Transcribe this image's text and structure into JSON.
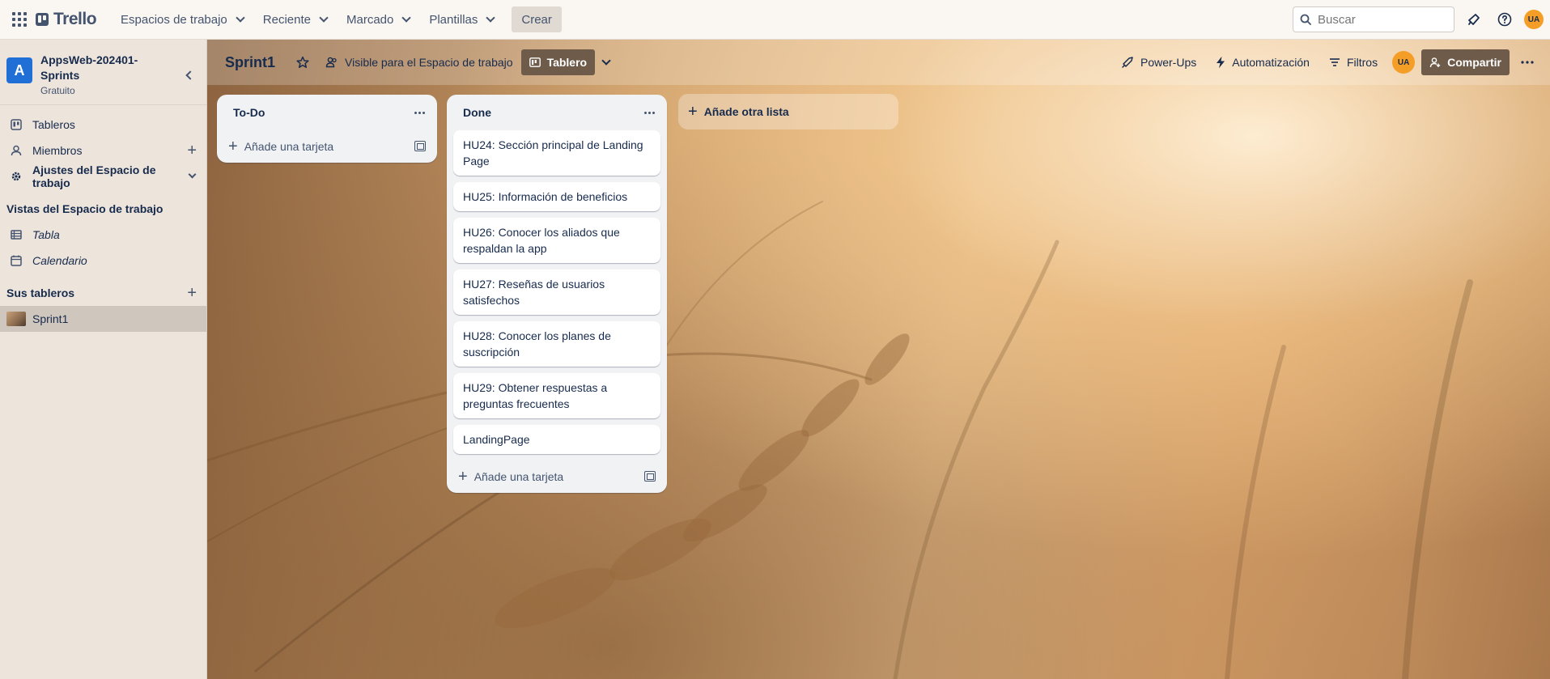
{
  "topbar": {
    "logo": "Trello",
    "nav": [
      {
        "label": "Espacios de trabajo"
      },
      {
        "label": "Reciente"
      },
      {
        "label": "Marcado"
      },
      {
        "label": "Plantillas"
      }
    ],
    "create_label": "Crear",
    "search_placeholder": "Buscar",
    "avatar_initials": "UA"
  },
  "sidebar": {
    "workspace_initial": "A",
    "workspace_name": "AppsWeb-202401-Sprints",
    "workspace_plan": "Gratuito",
    "items": [
      {
        "label": "Tableros"
      },
      {
        "label": "Miembros"
      },
      {
        "label": "Ajustes del Espacio de trabajo"
      }
    ],
    "views_title": "Vistas del Espacio de trabajo",
    "views": [
      {
        "label": "Tabla"
      },
      {
        "label": "Calendario"
      }
    ],
    "boards_title": "Sus tableros",
    "boards": [
      {
        "label": "Sprint1"
      }
    ]
  },
  "board": {
    "title": "Sprint1",
    "visibility_label": "Visible para el Espacio de trabajo",
    "view_label": "Tablero",
    "powerups_label": "Power-Ups",
    "automation_label": "Automatización",
    "filters_label": "Filtros",
    "member_initials": "UA",
    "share_label": "Compartir",
    "add_list_label": "Añade otra lista",
    "lists": [
      {
        "title": "To-Do",
        "cards": [],
        "add_card_label": "Añade una tarjeta"
      },
      {
        "title": "Done",
        "cards": [
          "HU24: Sección principal de Landing Page",
          "HU25: Información de beneficios",
          "HU26: Conocer los aliados que respaldan la app",
          "HU27: Reseñas de usuarios satisfechos",
          "HU28: Conocer los planes de suscripción",
          "HU29: Obtener respuestas a preguntas frecuentes",
          "LandingPage"
        ],
        "add_card_label": "Añade una tarjeta"
      }
    ]
  },
  "colors": {
    "workspace_badge": "#1f6fd6",
    "avatar": "#f59e27",
    "view_button": "#6e5b4a"
  }
}
